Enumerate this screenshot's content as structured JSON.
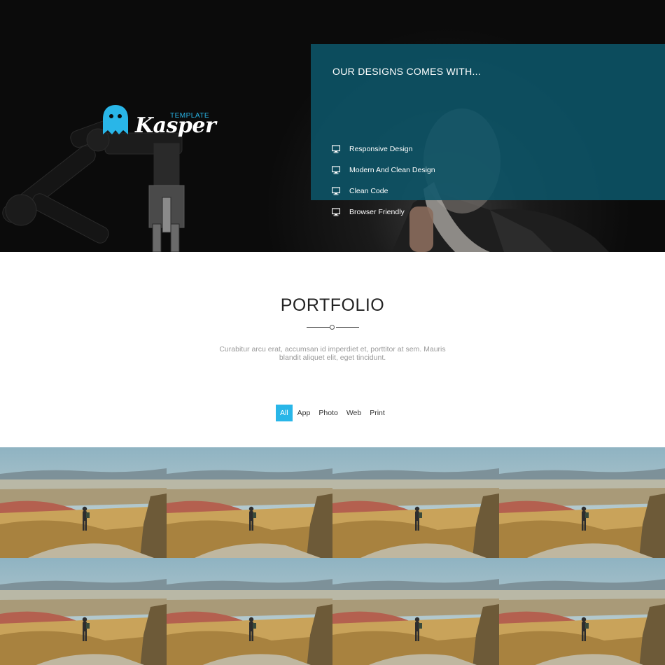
{
  "hero": {
    "brand": {
      "sub": "TEMPLATE",
      "name": "Kasper"
    },
    "features": {
      "title": "OUR DESIGNS COMES WITH...",
      "icon": "monitor-icon",
      "items": [
        {
          "label": "Responsive Design"
        },
        {
          "label": "Modern And Clean Design"
        },
        {
          "label": "Clean Code"
        },
        {
          "label": "Browser Friendly"
        }
      ]
    }
  },
  "portfolio": {
    "title": "PORTFOLIO",
    "intro_line1": "Curabitur arcu erat, accumsan id imperdiet et, porttitor at sem. Mauris",
    "intro_line2": "blandit aliquet elit, eget tincidunt.",
    "filters": [
      {
        "label": "All",
        "active": true
      },
      {
        "label": "App",
        "active": false
      },
      {
        "label": "Photo",
        "active": false
      },
      {
        "label": "Web",
        "active": false
      },
      {
        "label": "Print",
        "active": false
      }
    ],
    "tile_count": 8
  },
  "colors": {
    "accent": "#29b6e8",
    "features_panel": "#0c5569",
    "hero_bg": "#0b0b0b"
  }
}
